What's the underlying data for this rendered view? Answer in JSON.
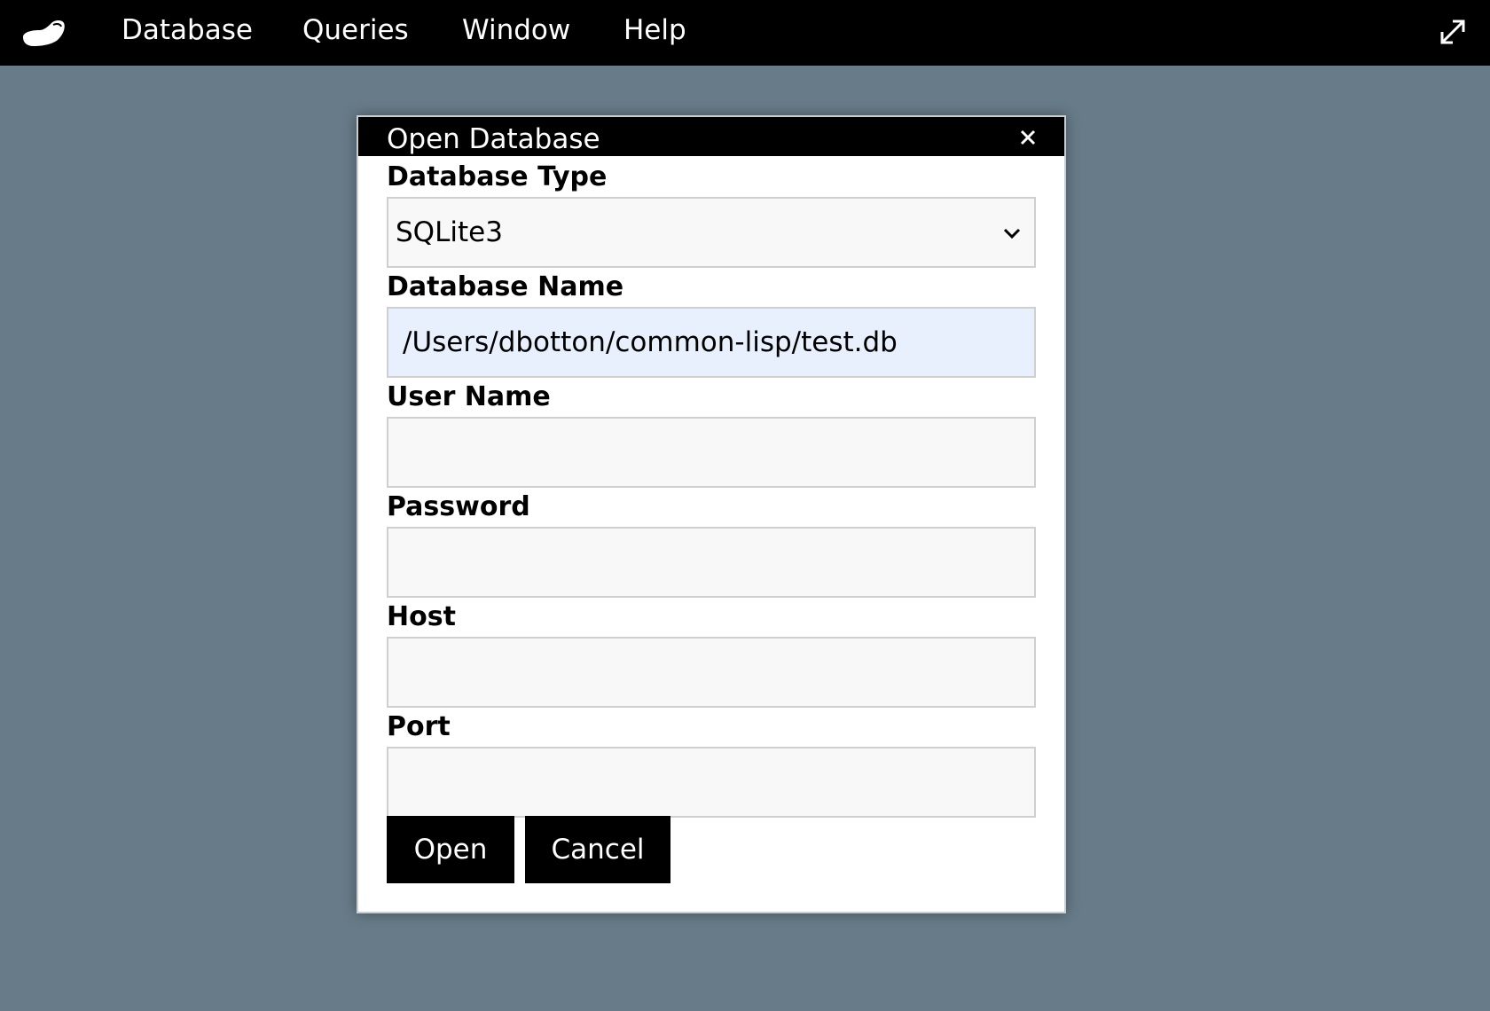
{
  "menubar": {
    "logo_icon": "clog-shoe-icon",
    "items": [
      {
        "label": "Database"
      },
      {
        "label": "Queries"
      },
      {
        "label": "Window"
      },
      {
        "label": "Help"
      }
    ],
    "expand_icon": "expand-arrows-icon"
  },
  "dialog": {
    "title": "Open Database",
    "close_icon": "close-icon",
    "fields": {
      "db_type": {
        "label": "Database Type",
        "selected": "SQLite3"
      },
      "db_name": {
        "label": "Database Name",
        "value": "/Users/dbotton/common-lisp/test.db"
      },
      "user_name": {
        "label": "User Name",
        "value": ""
      },
      "password": {
        "label": "Password",
        "value": ""
      },
      "host": {
        "label": "Host",
        "value": ""
      },
      "port": {
        "label": "Port",
        "value": ""
      }
    },
    "buttons": {
      "open": "Open",
      "cancel": "Cancel"
    }
  },
  "colors": {
    "background": "#677b88",
    "menubar": "#000000",
    "autofill": "#e8f0fe"
  }
}
